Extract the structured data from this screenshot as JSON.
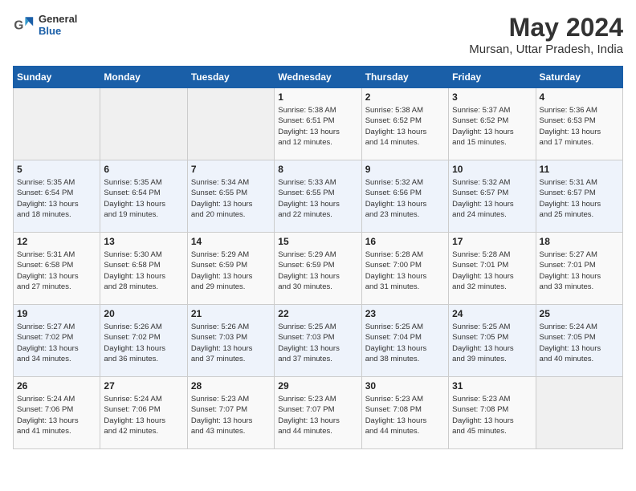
{
  "header": {
    "logo": {
      "general": "General",
      "blue": "Blue"
    },
    "title": "May 2024",
    "subtitle": "Mursan, Uttar Pradesh, India"
  },
  "days_of_week": [
    "Sunday",
    "Monday",
    "Tuesday",
    "Wednesday",
    "Thursday",
    "Friday",
    "Saturday"
  ],
  "weeks": [
    {
      "cells": [
        {
          "day": null,
          "info": null
        },
        {
          "day": null,
          "info": null
        },
        {
          "day": null,
          "info": null
        },
        {
          "day": "1",
          "info": "Sunrise: 5:38 AM\nSunset: 6:51 PM\nDaylight: 13 hours\nand 12 minutes."
        },
        {
          "day": "2",
          "info": "Sunrise: 5:38 AM\nSunset: 6:52 PM\nDaylight: 13 hours\nand 14 minutes."
        },
        {
          "day": "3",
          "info": "Sunrise: 5:37 AM\nSunset: 6:52 PM\nDaylight: 13 hours\nand 15 minutes."
        },
        {
          "day": "4",
          "info": "Sunrise: 5:36 AM\nSunset: 6:53 PM\nDaylight: 13 hours\nand 17 minutes."
        }
      ]
    },
    {
      "cells": [
        {
          "day": "5",
          "info": "Sunrise: 5:35 AM\nSunset: 6:54 PM\nDaylight: 13 hours\nand 18 minutes."
        },
        {
          "day": "6",
          "info": "Sunrise: 5:35 AM\nSunset: 6:54 PM\nDaylight: 13 hours\nand 19 minutes."
        },
        {
          "day": "7",
          "info": "Sunrise: 5:34 AM\nSunset: 6:55 PM\nDaylight: 13 hours\nand 20 minutes."
        },
        {
          "day": "8",
          "info": "Sunrise: 5:33 AM\nSunset: 6:55 PM\nDaylight: 13 hours\nand 22 minutes."
        },
        {
          "day": "9",
          "info": "Sunrise: 5:32 AM\nSunset: 6:56 PM\nDaylight: 13 hours\nand 23 minutes."
        },
        {
          "day": "10",
          "info": "Sunrise: 5:32 AM\nSunset: 6:57 PM\nDaylight: 13 hours\nand 24 minutes."
        },
        {
          "day": "11",
          "info": "Sunrise: 5:31 AM\nSunset: 6:57 PM\nDaylight: 13 hours\nand 25 minutes."
        }
      ]
    },
    {
      "cells": [
        {
          "day": "12",
          "info": "Sunrise: 5:31 AM\nSunset: 6:58 PM\nDaylight: 13 hours\nand 27 minutes."
        },
        {
          "day": "13",
          "info": "Sunrise: 5:30 AM\nSunset: 6:58 PM\nDaylight: 13 hours\nand 28 minutes."
        },
        {
          "day": "14",
          "info": "Sunrise: 5:29 AM\nSunset: 6:59 PM\nDaylight: 13 hours\nand 29 minutes."
        },
        {
          "day": "15",
          "info": "Sunrise: 5:29 AM\nSunset: 6:59 PM\nDaylight: 13 hours\nand 30 minutes."
        },
        {
          "day": "16",
          "info": "Sunrise: 5:28 AM\nSunset: 7:00 PM\nDaylight: 13 hours\nand 31 minutes."
        },
        {
          "day": "17",
          "info": "Sunrise: 5:28 AM\nSunset: 7:01 PM\nDaylight: 13 hours\nand 32 minutes."
        },
        {
          "day": "18",
          "info": "Sunrise: 5:27 AM\nSunset: 7:01 PM\nDaylight: 13 hours\nand 33 minutes."
        }
      ]
    },
    {
      "cells": [
        {
          "day": "19",
          "info": "Sunrise: 5:27 AM\nSunset: 7:02 PM\nDaylight: 13 hours\nand 34 minutes."
        },
        {
          "day": "20",
          "info": "Sunrise: 5:26 AM\nSunset: 7:02 PM\nDaylight: 13 hours\nand 36 minutes."
        },
        {
          "day": "21",
          "info": "Sunrise: 5:26 AM\nSunset: 7:03 PM\nDaylight: 13 hours\nand 37 minutes."
        },
        {
          "day": "22",
          "info": "Sunrise: 5:25 AM\nSunset: 7:03 PM\nDaylight: 13 hours\nand 37 minutes."
        },
        {
          "day": "23",
          "info": "Sunrise: 5:25 AM\nSunset: 7:04 PM\nDaylight: 13 hours\nand 38 minutes."
        },
        {
          "day": "24",
          "info": "Sunrise: 5:25 AM\nSunset: 7:05 PM\nDaylight: 13 hours\nand 39 minutes."
        },
        {
          "day": "25",
          "info": "Sunrise: 5:24 AM\nSunset: 7:05 PM\nDaylight: 13 hours\nand 40 minutes."
        }
      ]
    },
    {
      "cells": [
        {
          "day": "26",
          "info": "Sunrise: 5:24 AM\nSunset: 7:06 PM\nDaylight: 13 hours\nand 41 minutes."
        },
        {
          "day": "27",
          "info": "Sunrise: 5:24 AM\nSunset: 7:06 PM\nDaylight: 13 hours\nand 42 minutes."
        },
        {
          "day": "28",
          "info": "Sunrise: 5:23 AM\nSunset: 7:07 PM\nDaylight: 13 hours\nand 43 minutes."
        },
        {
          "day": "29",
          "info": "Sunrise: 5:23 AM\nSunset: 7:07 PM\nDaylight: 13 hours\nand 44 minutes."
        },
        {
          "day": "30",
          "info": "Sunrise: 5:23 AM\nSunset: 7:08 PM\nDaylight: 13 hours\nand 44 minutes."
        },
        {
          "day": "31",
          "info": "Sunrise: 5:23 AM\nSunset: 7:08 PM\nDaylight: 13 hours\nand 45 minutes."
        },
        {
          "day": null,
          "info": null
        }
      ]
    }
  ]
}
